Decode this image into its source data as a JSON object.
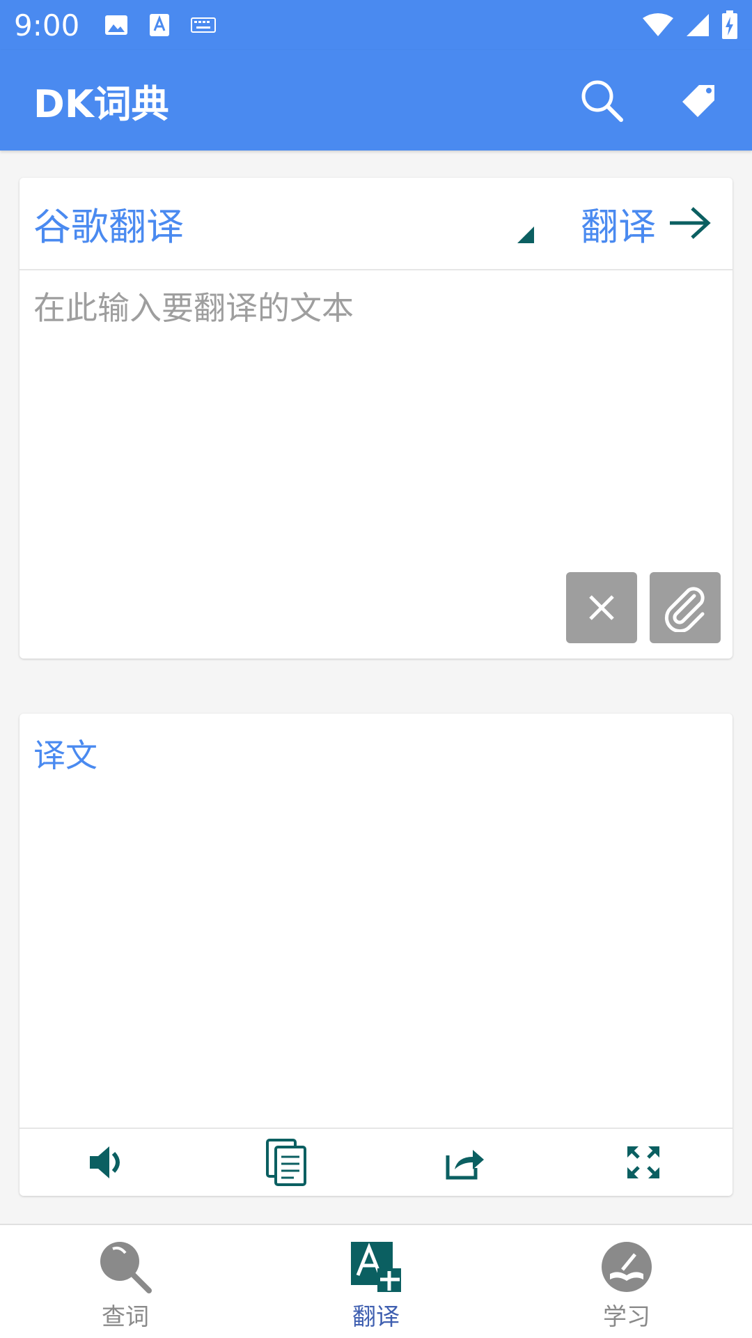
{
  "status_bar": {
    "time": "9:00",
    "left_icons": [
      "image-icon",
      "text-a-icon",
      "keyboard-icon"
    ],
    "right_icons": [
      "wifi-icon",
      "signal-icon",
      "battery-charging-icon"
    ]
  },
  "app_bar": {
    "title": "DK词典",
    "actions": [
      "search-icon",
      "tag-icon"
    ]
  },
  "input_card": {
    "engine_label": "谷歌翻译",
    "translate_label": "翻译",
    "input_placeholder": "在此输入要翻译的文本",
    "tools": [
      "close-icon",
      "paperclip-icon"
    ]
  },
  "output_card": {
    "label": "译文",
    "actions": [
      "speaker-icon",
      "copy-icon",
      "share-icon",
      "expand-icon"
    ]
  },
  "bottom_nav": {
    "items": [
      {
        "label": "查词",
        "icon": "magnifier-icon",
        "active": false
      },
      {
        "label": "翻译",
        "icon": "translate-icon",
        "active": true
      },
      {
        "label": "学习",
        "icon": "study-book-icon",
        "active": false
      }
    ]
  },
  "colors": {
    "primary": "#4a8af0",
    "accent": "#0b5f61",
    "gray_button": "#9e9e9e",
    "nav_active": "#3f5fb0"
  }
}
